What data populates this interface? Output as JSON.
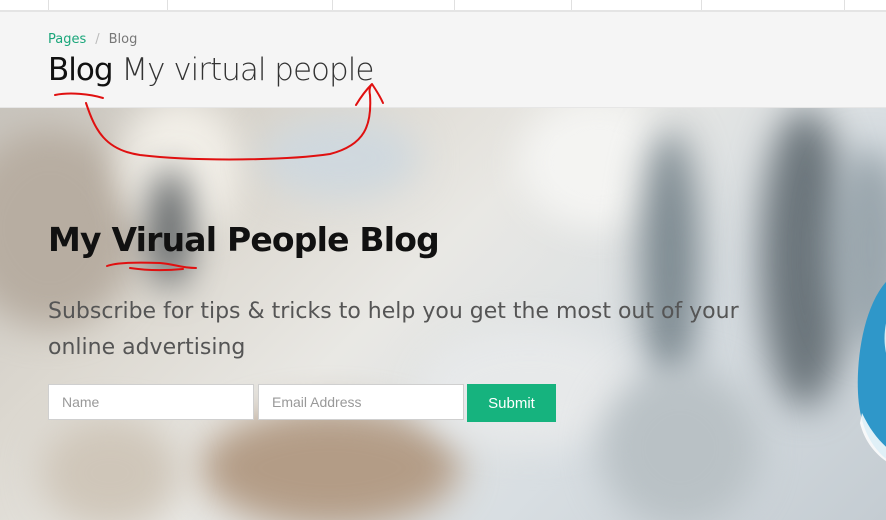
{
  "breadcrumb": {
    "parent": "Pages",
    "current": "Blog"
  },
  "page_title": {
    "strong": "Blog",
    "light": "My virtual people"
  },
  "hero": {
    "title": "My Virual People Blog",
    "subtitle": "Subscribe for tips & tricks to help you get the most out of your online advertising"
  },
  "form": {
    "name_placeholder": "Name",
    "email_placeholder": "Email Address",
    "submit_label": "Submit"
  },
  "colors": {
    "accent": "#16b37e",
    "breadcrumb_link": "#1aa67a",
    "annotation": "#e01010"
  }
}
